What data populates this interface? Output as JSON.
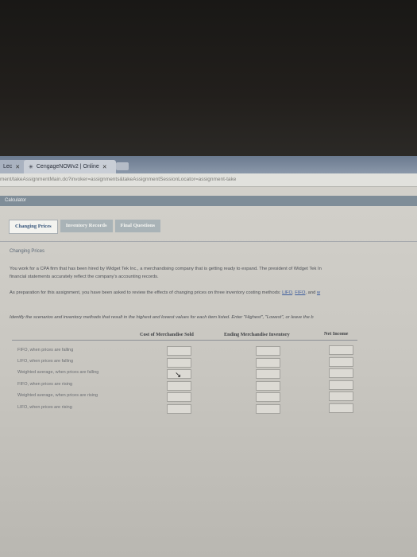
{
  "browser": {
    "tabs": [
      {
        "label": "Lec"
      },
      {
        "label": "CengageNOWv2 | Online"
      }
    ],
    "url": "ment/takeAssignmentMain.do?invoker=assignments&takeAssignmentSessionLocator=assignment-take"
  },
  "toolbar": {
    "calculator_label": "Calculator"
  },
  "app_tabs": [
    {
      "label": "Changing Prices"
    },
    {
      "label": "Inventory Records"
    },
    {
      "label": "Final Questions"
    }
  ],
  "section": {
    "title": "Changing Prices",
    "intro_line1": "You work for a CPA firm that has been hired by Widget Tek Inc., a merchandising company that is getting ready to expand. The president of Widget Tek In",
    "intro_line2": "financial statements accurately reflect the company's accounting records.",
    "prep_text": "As preparation for this assignment, you have been asked to review the effects of changing prices on three inventory costing methods:",
    "method_lifo": "LIFO",
    "method_fifo": "FIFO",
    "method_and": ", and",
    "method_third": "w",
    "instruction": "Identify the scenarios and inventory methods that result in the highest and lowest values for each item listed. Enter \"Highest\", \"Lowest\", or leave the b"
  },
  "table": {
    "headers": [
      "Cost of Merchandise Sold",
      "Ending Merchandise Inventory",
      "Net Income"
    ],
    "rows": [
      {
        "label": "FIFO, when prices are falling",
        "cogs": "",
        "ending_inventory": "",
        "net_income": ""
      },
      {
        "label": "LIFO, when prices are falling",
        "cogs": "",
        "ending_inventory": "",
        "net_income": ""
      },
      {
        "label": "Weighted average, when prices are falling",
        "cogs": "",
        "ending_inventory": "",
        "net_income": ""
      },
      {
        "label": "FIFO, when prices are rising",
        "cogs": "",
        "ending_inventory": "",
        "net_income": ""
      },
      {
        "label": "Weighted average, when prices are rising",
        "cogs": "",
        "ending_inventory": "",
        "net_income": ""
      },
      {
        "label": "LIFO, when prices are rising",
        "cogs": "",
        "ending_inventory": "",
        "net_income": ""
      }
    ]
  }
}
